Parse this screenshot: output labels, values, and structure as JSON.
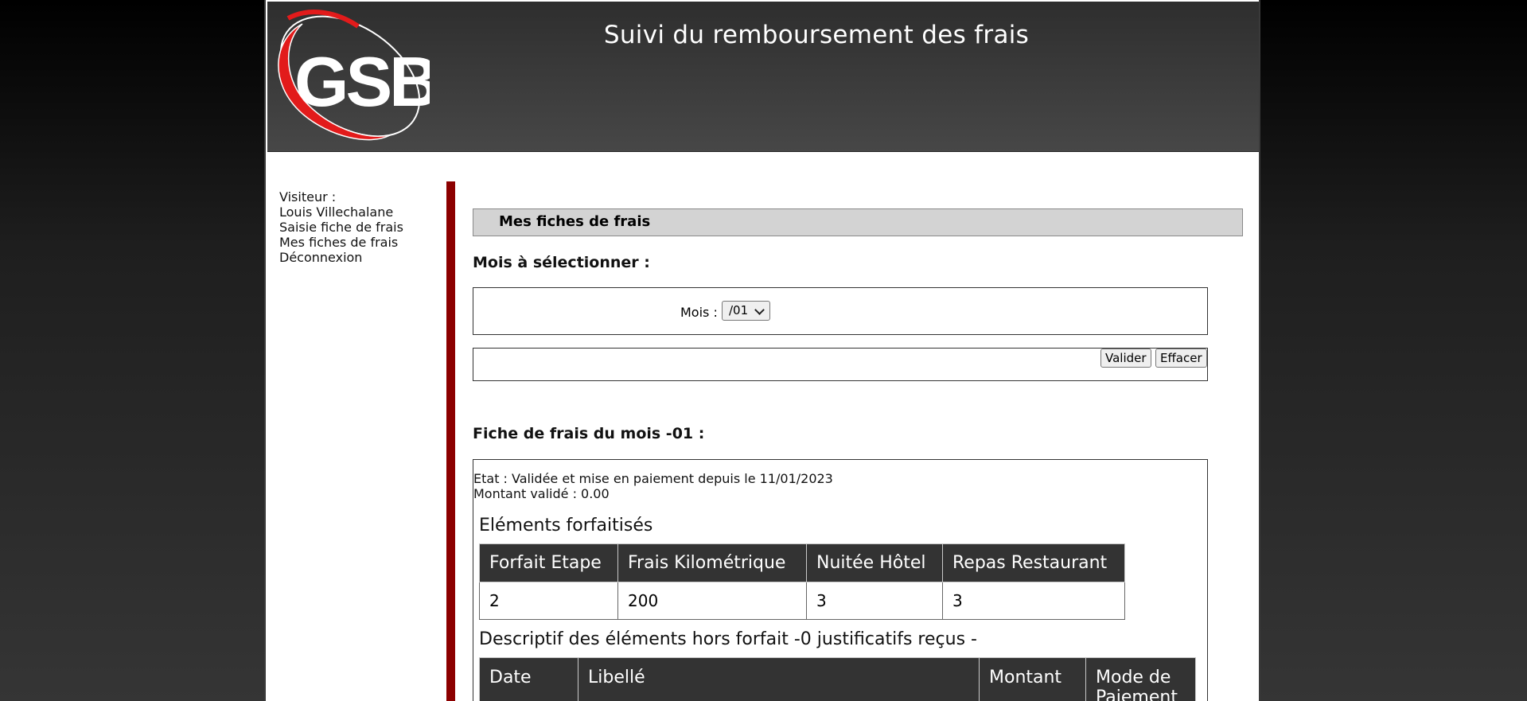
{
  "header": {
    "logo_text": "GSB",
    "title": "Suivi du remboursement des frais"
  },
  "sidebar": {
    "visitor_label": "Visiteur :",
    "visitor_name": "Louis Villechalane",
    "items": [
      {
        "label": "Saisie fiche de frais"
      },
      {
        "label": "Mes fiches de frais"
      },
      {
        "label": "Déconnexion"
      }
    ]
  },
  "main": {
    "page_title": "Mes fiches de frais",
    "select_heading": "Mois à sélectionner :",
    "mois_label": "Mois :",
    "mois_selected": "/01",
    "valider_label": "Valider",
    "effacer_label": "Effacer",
    "fiche_heading": "Fiche de frais du mois -01 :",
    "etat": "Etat : Validée et mise en paiement depuis le 11/01/2023",
    "montant": "Montant validé : 0.00",
    "forfait_heading": "Eléments forfaitisés",
    "forfait_table": {
      "headers": [
        "Forfait Etape",
        "Frais Kilométrique",
        "Nuitée Hôtel",
        "Repas Restaurant"
      ],
      "values": [
        "2",
        "200",
        "3",
        "3"
      ]
    },
    "hors_forfait_heading": "Descriptif des éléments hors forfait -0 justificatifs reçus -",
    "hors_forfait_table": {
      "headers": [
        "Date",
        "Libellé",
        "Montant",
        "Mode de Paiement"
      ]
    }
  },
  "colors": {
    "accent_red": "#8c0000",
    "header_bg": "#3a3a3a",
    "table_header_bg": "#333333",
    "title_band_bg": "#d3d3d3"
  }
}
